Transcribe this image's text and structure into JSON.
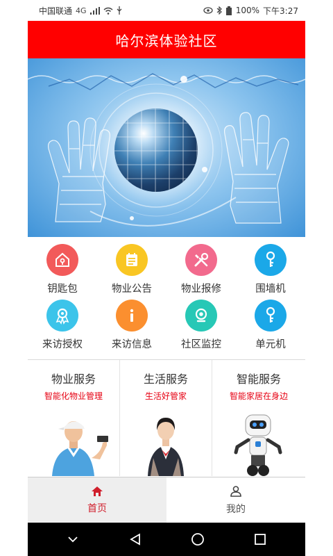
{
  "status_bar": {
    "carrier": "中国联通",
    "network": "4G",
    "battery": "100%",
    "time": "下午3:27"
  },
  "header": {
    "title": "哈尔滨体验社区"
  },
  "grid": [
    {
      "label": "钥匙包",
      "icon": "key-bag-icon",
      "color": "#f25a5a"
    },
    {
      "label": "物业公告",
      "icon": "notice-icon",
      "color": "#f9c623"
    },
    {
      "label": "物业报修",
      "icon": "repair-icon",
      "color": "#f26a8d"
    },
    {
      "label": "围墙机",
      "icon": "key-icon",
      "color": "#1ba8e8"
    },
    {
      "label": "来访授权",
      "icon": "authorize-icon",
      "color": "#3cc4ea"
    },
    {
      "label": "来访信息",
      "icon": "info-icon",
      "color": "#fb8f2f"
    },
    {
      "label": "社区监控",
      "icon": "camera-icon",
      "color": "#27c8b6"
    },
    {
      "label": "单元机",
      "icon": "key-icon",
      "color": "#1ba8e8"
    }
  ],
  "services": [
    {
      "title": "物业服务",
      "subtitle": "智能化物业管理"
    },
    {
      "title": "生活服务",
      "subtitle": "生活好管家"
    },
    {
      "title": "智能服务",
      "subtitle": "智能家居在身边"
    }
  ],
  "tabs": [
    {
      "label": "首页",
      "icon": "home-icon"
    },
    {
      "label": "我的",
      "icon": "user-icon"
    }
  ],
  "colors": {
    "brand": "#ff0000",
    "accent_text": "#e60012",
    "active_tab": "#d01f2c"
  }
}
